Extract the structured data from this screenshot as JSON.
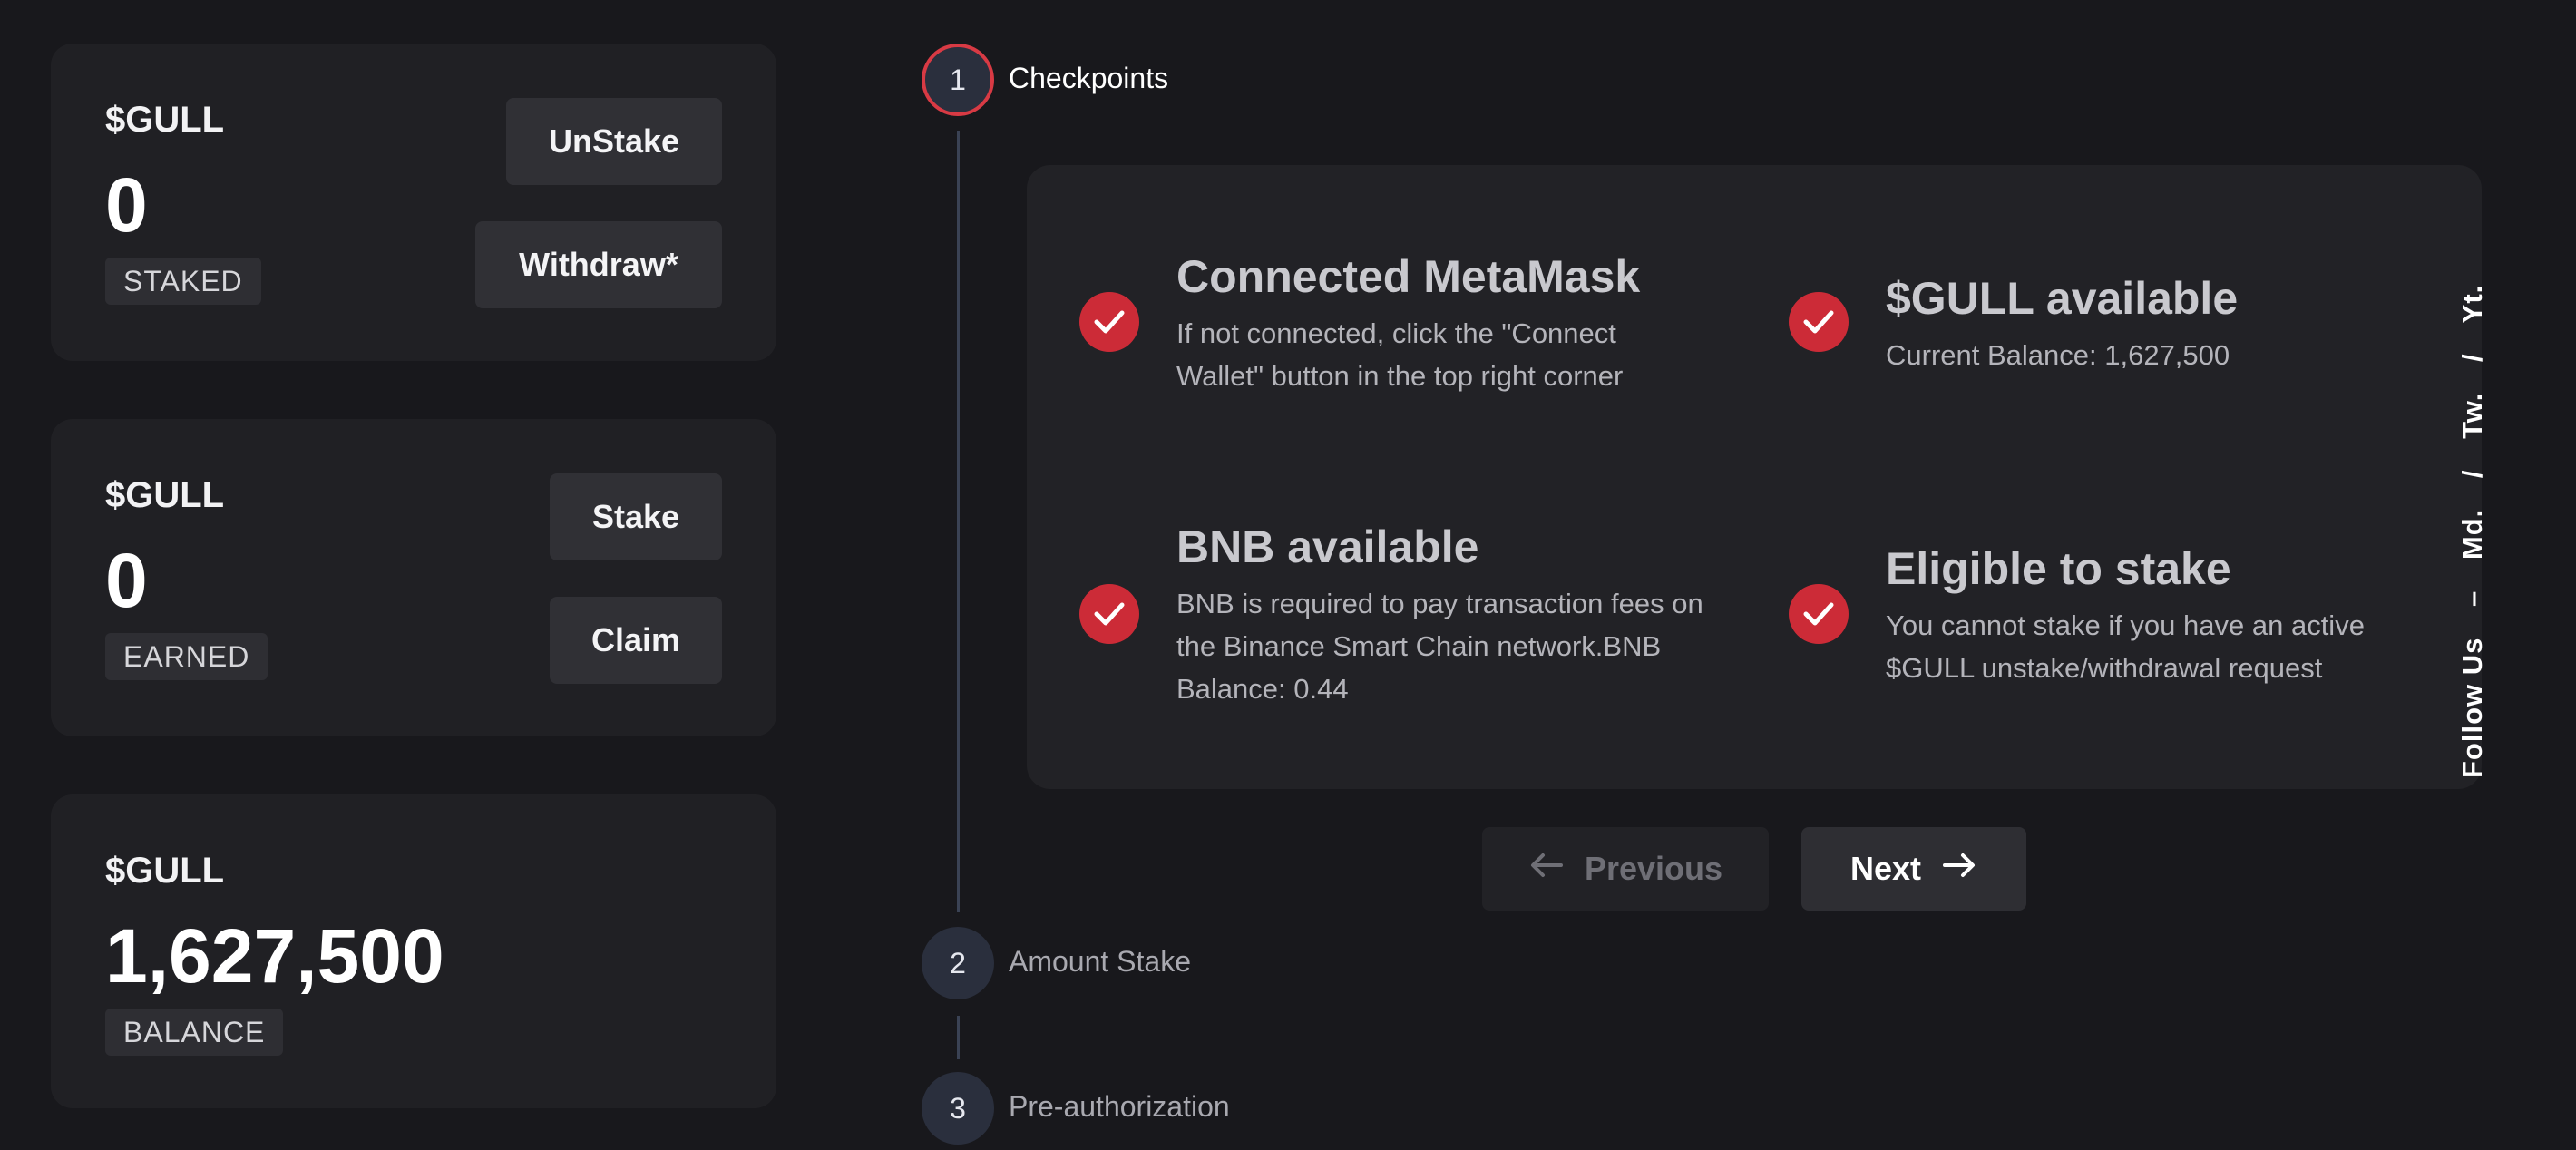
{
  "cards": [
    {
      "token": "$GULL",
      "amount": "0",
      "tag": "STAKED",
      "buttons": [
        "UnStake",
        "Withdraw*"
      ]
    },
    {
      "token": "$GULL",
      "amount": "0",
      "tag": "EARNED",
      "buttons": [
        "Stake",
        "Claim"
      ]
    },
    {
      "token": "$GULL",
      "amount": "1,627,500",
      "tag": "BALANCE"
    }
  ],
  "steps": [
    {
      "number": "1",
      "label": "Checkpoints",
      "active": true
    },
    {
      "number": "2",
      "label": "Amount Stake",
      "active": false
    },
    {
      "number": "3",
      "label": "Pre-authorization",
      "active": false
    }
  ],
  "checkpoints": [
    {
      "title": "Connected MetaMask",
      "desc": "If not connected, click the \"Connect Wallet\" button in the top right corner",
      "status": "checked"
    },
    {
      "title": "$GULL available",
      "desc": "Current Balance: 1,627,500",
      "status": "checked"
    },
    {
      "title": "BNB available",
      "desc": "BNB is required to pay transaction fees on the Binance Smart Chain network.BNB Balance: 0.44",
      "status": "checked"
    },
    {
      "title": "Eligible to stake",
      "desc": "You cannot stake if you have an active $GULL unstake/withdrawal request",
      "status": "checked"
    }
  ],
  "navigation": {
    "previous": "Previous",
    "next": "Next"
  },
  "social": {
    "label": "Follow Us",
    "dash": "–",
    "links": [
      "Md.",
      "/",
      "Tw.",
      "/",
      "Yt."
    ]
  },
  "colors": {
    "accent": "#cc2b37",
    "background": "#18181c",
    "card": "#202024"
  },
  "icons": {
    "check": "check-icon",
    "previous": "arrow-left-icon",
    "next": "arrow-right-icon"
  }
}
